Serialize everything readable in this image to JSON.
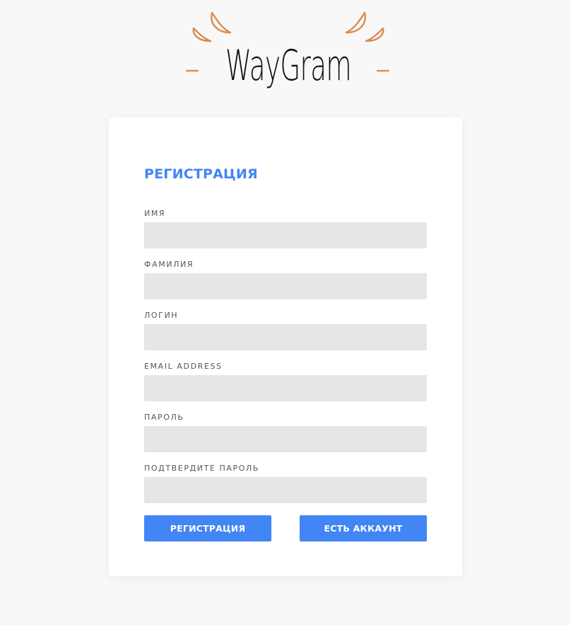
{
  "logo": {
    "text": "WayGram",
    "accent_color": "#db8a52",
    "icon": "horns-logo-icon"
  },
  "form": {
    "title": "РЕГИСТРАЦИЯ",
    "fields": [
      {
        "label": "ИМЯ",
        "value": "",
        "placeholder": ""
      },
      {
        "label": "ФАМИЛИЯ",
        "value": "",
        "placeholder": ""
      },
      {
        "label": "ЛОГИН",
        "value": "",
        "placeholder": ""
      },
      {
        "label": "EMAIL ADDRESS",
        "value": "",
        "placeholder": ""
      },
      {
        "label": "ПАРОЛЬ",
        "value": "",
        "placeholder": ""
      },
      {
        "label": "ПОДТВЕРДИТЕ ПАРОЛЬ",
        "value": "",
        "placeholder": ""
      }
    ],
    "buttons": {
      "register": "РЕГИСТРАЦИЯ",
      "have_account": "ЕСТЬ АККАУНТ"
    }
  },
  "colors": {
    "accent": "#4285f4",
    "input_bg": "#e6e6e6",
    "page_bg": "#f8f8f8",
    "card_bg": "#ffffff"
  }
}
